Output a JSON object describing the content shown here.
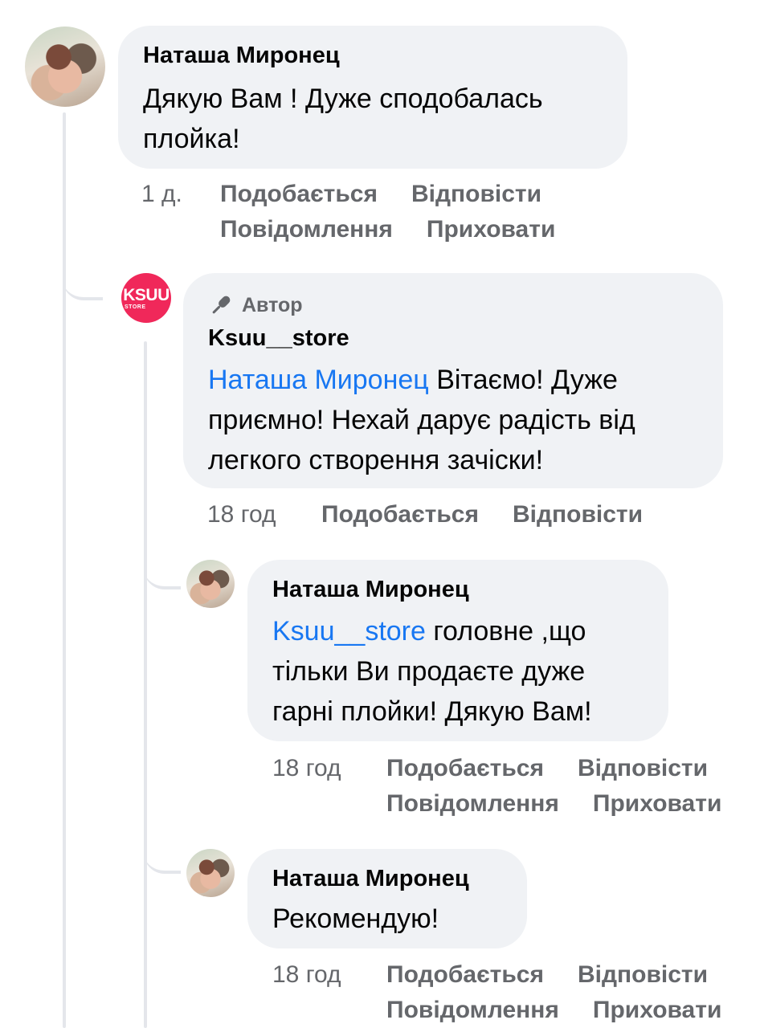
{
  "comments": [
    {
      "author": "Наташа Миронец",
      "text": "Дякую Вам ! Дуже сподобалась плойка!",
      "time": "1 д.",
      "actions": {
        "like": "Подобається",
        "reply": "Відповісти",
        "message": "Повідомлення",
        "hide": "Приховати"
      }
    }
  ],
  "replies": [
    {
      "badge": "Автор",
      "badge_icon": "microphone-icon",
      "author": "Ksuu__store",
      "avatar_logo": "KSUU",
      "avatar_logo_sub": "STORE",
      "mention": "Наташа Миронец",
      "text_line1": "Вітаємо! Дуже",
      "text_line2": "приємно! Нехай дарує радість від",
      "text_line3": "легкого створення зачіски!",
      "time": "18 год",
      "actions": {
        "like": "Подобається",
        "reply": "Відповісти"
      }
    },
    {
      "author": "Наташа Миронец",
      "mention": "Ksuu__store",
      "text_line1": "головне ,що",
      "text_line2": "тільки Ви продаєте дуже",
      "text_line3": "гарні плойки! Дякую Вам!",
      "time": "18 год",
      "actions": {
        "like": "Подобається",
        "reply": "Відповісти",
        "message": "Повідомлення",
        "hide": "Приховати"
      }
    },
    {
      "author": "Наташа Миронец",
      "text": "Рекомендую!",
      "time": "18 год",
      "actions": {
        "like": "Подобається",
        "reply": "Відповісти",
        "message": "Повідомлення",
        "hide": "Приховати"
      }
    }
  ],
  "colors": {
    "bubble_bg": "#f0f2f5",
    "mention": "#1877f2",
    "meta_text": "#65676b",
    "thread_line": "#e4e6eb",
    "store_brand": "#f0285a"
  }
}
